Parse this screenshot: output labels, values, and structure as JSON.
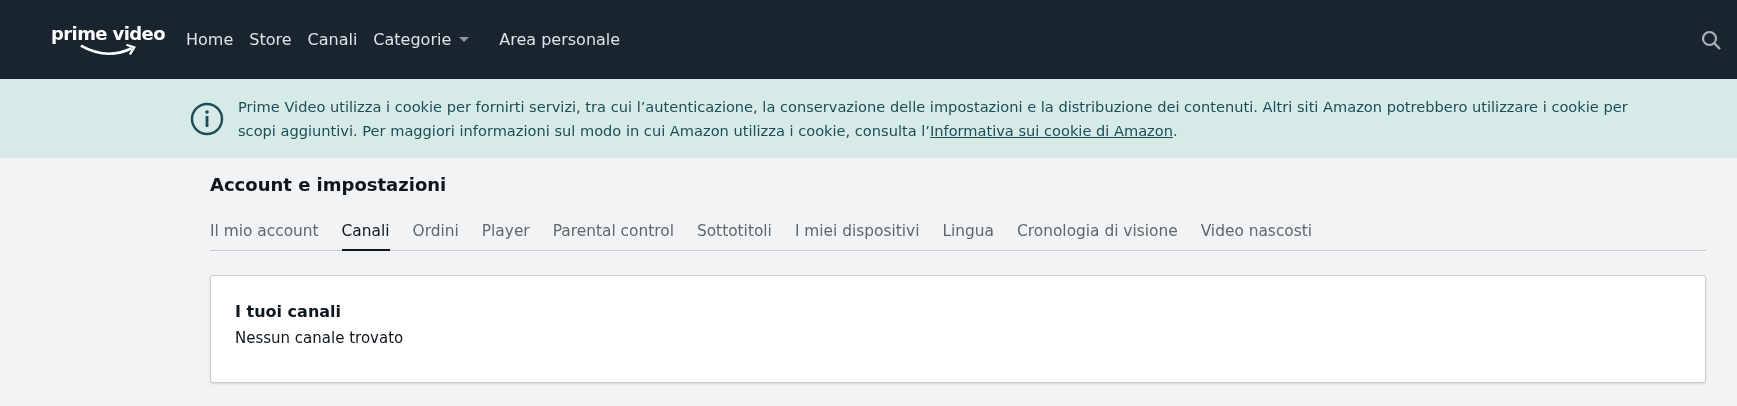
{
  "header": {
    "logo": "prime video",
    "nav": [
      {
        "label": "Home",
        "kind": "link"
      },
      {
        "label": "Store",
        "kind": "link"
      },
      {
        "label": "Canali",
        "kind": "link"
      },
      {
        "label": "Categorie",
        "kind": "dropdown"
      },
      {
        "label": "Area personale",
        "kind": "link"
      }
    ]
  },
  "cookie_banner": {
    "text": "Prime Video utilizza i cookie per fornirti servizi, tra cui l’autenticazione, la conservazione delle impostazioni e la distribuzione dei contenuti. Altri siti Amazon potrebbero utilizzare i cookie per scopi aggiuntivi. Per maggiori informazioni sul modo in cui Amazon utilizza i cookie, consulta l’",
    "link": "Informativa sui cookie di Amazon",
    "text_end": "."
  },
  "page_title": "Account e impostazioni",
  "tabs": [
    {
      "label": "Il mio account",
      "selected": false
    },
    {
      "label": "Canali",
      "selected": true
    },
    {
      "label": "Ordini",
      "selected": false
    },
    {
      "label": "Player",
      "selected": false
    },
    {
      "label": "Parental control",
      "selected": false
    },
    {
      "label": "Sottotitoli",
      "selected": false
    },
    {
      "label": "I miei dispositivi",
      "selected": false
    },
    {
      "label": "Lingua",
      "selected": false
    },
    {
      "label": "Cronologia di visione",
      "selected": false
    },
    {
      "label": "Video nascosti",
      "selected": false
    }
  ],
  "card": {
    "title": "I tuoi canali",
    "message": "Nessun canale trovato"
  }
}
